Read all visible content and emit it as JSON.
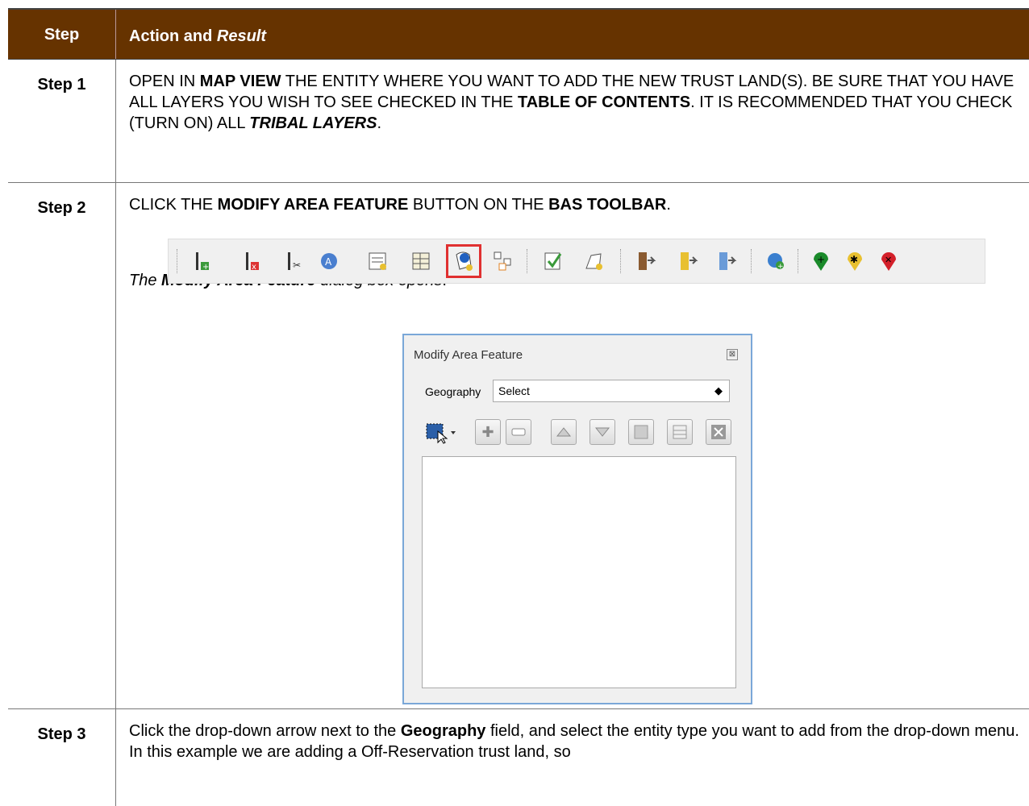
{
  "header": {
    "step": "Step",
    "action_prefix": "Action and ",
    "action_result": "Result"
  },
  "step1": {
    "label": "Step 1",
    "t1": "OPEN IN ",
    "b1": "MAP VIEW",
    "t2": " THE ENTITY WHERE YOU WANT TO ADD THE NEW TRUST LAND(S). BE SURE THAT YOU HAVE ALL LAYERS YOU WISH TO SEE CHECKED IN THE ",
    "b2": "TABLE OF CONTENTS",
    "t3": ". IT IS RECOMMENDED THAT YOU CHECK (TURN ON) ALL ",
    "b3": "TRIBAL LAYERS",
    "t4": "."
  },
  "step2": {
    "label": "Step 2",
    "t1": "CLICK THE ",
    "b1": "MODIFY AREA FEATURE",
    "t2": " BUTTON ON THE ",
    "b2": "BAS TOOLBAR",
    "t3": ".",
    "r1": "The ",
    "r2": "Modify Area Feature",
    "r3": " dialog box opens",
    "r4": "."
  },
  "toolbar": {
    "icons": [
      "add-line-icon",
      "delete-line-icon",
      "split-line-icon",
      "label-icon",
      "attribute-table-icon",
      "edit-table-icon",
      "modify-area-icon",
      "topology-icon",
      "check-icon",
      "polygon-edit-icon",
      "import-icon",
      "export-yellow-icon",
      "export-blue-icon",
      "globe-add-icon",
      "pin-add-icon",
      "pin-star-icon",
      "pin-delete-icon"
    ]
  },
  "dialog": {
    "title": "Modify Area Feature",
    "close": "⊠",
    "geography_label": "Geography",
    "geography_value": "Select"
  },
  "step3": {
    "label": "Step 3",
    "t1": "Click the drop-down arrow next to the ",
    "b1": "Geography",
    "t2": " field, and select the entity type you want to add from the drop-down menu. In this example we are adding a Off-Reservation trust land, so"
  },
  "colors": {
    "header_bg": "#663300",
    "dialog_border": "#7aa7d8",
    "highlight": "#e03030"
  }
}
